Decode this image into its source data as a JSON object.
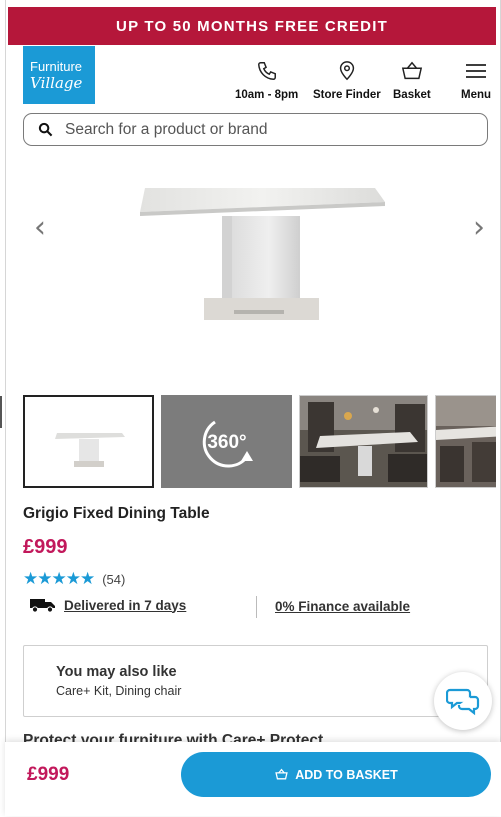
{
  "promo": {
    "text": "UP TO 50 MONTHS FREE CREDIT"
  },
  "logo": {
    "line1": "Furniture",
    "line2": "Village"
  },
  "header": {
    "phone_label": "10am - 8pm",
    "store_finder_label": "Store Finder",
    "basket_label": "Basket",
    "menu_label": "Menu"
  },
  "search": {
    "placeholder": "Search for a product or brand"
  },
  "gallery": {
    "prev": "‹",
    "next": "›",
    "badge_360": "360°"
  },
  "product": {
    "title": "Grigio Fixed Dining Table",
    "price": "£999",
    "rating_stars": 5,
    "review_count": "(54)",
    "delivery": "Delivered in 7 days",
    "finance": "0% Finance available"
  },
  "also_like": {
    "heading": "You may also like",
    "items": "Care+ Kit, Dining chair"
  },
  "protect": {
    "heading": "Protect your furniture with Care+ Protect"
  },
  "bottom": {
    "price": "£999",
    "button_label": "ADD TO BASKET"
  },
  "colors": {
    "brand": "#1b9ad6",
    "promo": "#b5173a",
    "price": "#c2185b"
  }
}
